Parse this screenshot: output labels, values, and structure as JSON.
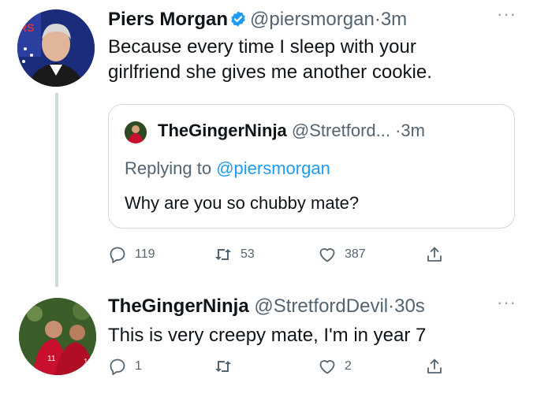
{
  "tweets": [
    {
      "author": {
        "name": "Piers Morgan",
        "handle": "@piersmorgan",
        "verified": true,
        "avatar_icon": "profile-photo-man-in-suit"
      },
      "separator": "·",
      "time": "3m",
      "more_label": "···",
      "text_lines": [
        "Because every time I sleep with your",
        "girlfriend she gives me another cookie."
      ],
      "quote": {
        "author_name": "TheGingerNinja",
        "author_handle": "@Stretford...",
        "separator": "·",
        "time": "3m",
        "replying_prefix": "Replying to",
        "replying_handle": "@piersmorgan",
        "text": "Why are you so chubby mate?",
        "avatar_icon": "profile-photo-red-jersey"
      },
      "actions": {
        "reply_count": "119",
        "retweet_count": "53",
        "like_count": "387",
        "share_count": ""
      }
    },
    {
      "author": {
        "name": "TheGingerNinja",
        "handle": "@StretfordDevil",
        "verified": false,
        "avatar_icon": "profile-photo-footballers"
      },
      "separator": "·",
      "time": "30s",
      "more_label": "···",
      "text_lines": [
        "This is very creepy mate, I'm in year 7"
      ],
      "actions": {
        "reply_count": "1",
        "retweet_count": "",
        "like_count": "2",
        "share_count": ""
      }
    }
  ],
  "colors": {
    "text": "#0f1419",
    "secondary": "#536471",
    "accent": "#1d9bf0",
    "border": "#cfd9de"
  }
}
